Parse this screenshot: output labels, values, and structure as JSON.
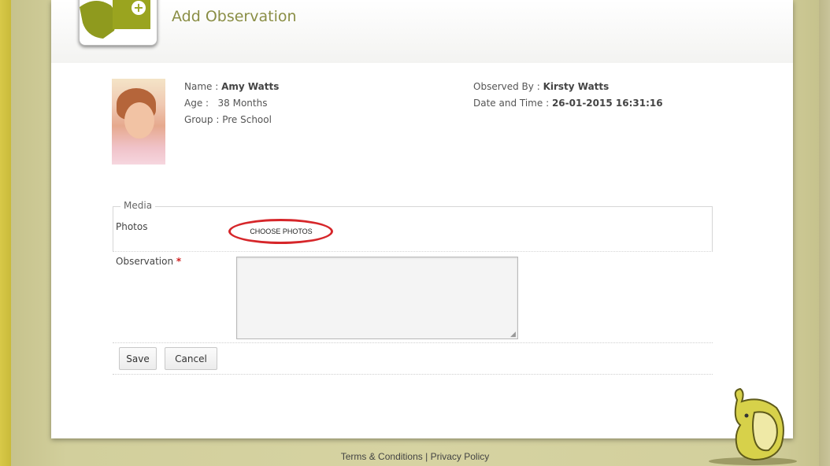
{
  "page": {
    "title": "Add Observation"
  },
  "child": {
    "name_label": "Name : ",
    "name": "Amy Watts",
    "age_label": "Age : ",
    "age": "38 Months",
    "group_label": "Group : ",
    "group": "Pre School"
  },
  "observation_meta": {
    "observed_by_label": "Observed By : ",
    "observed_by": "Kirsty Watts",
    "datetime_label": "Date and Time : ",
    "datetime": "26-01-2015 16:31:16"
  },
  "media": {
    "legend": "Media",
    "photos_label": "Photos",
    "choose_photos": "CHOOSE PHOTOS"
  },
  "observation": {
    "label": "Observation",
    "required_mark": "*",
    "value": ""
  },
  "actions": {
    "save": "Save",
    "cancel": "Cancel"
  },
  "footer": {
    "terms": "Terms & Conditions",
    "separator": "|",
    "privacy": "Privacy Policy"
  },
  "colors": {
    "title": "#8a8e45",
    "brand_green": "#9aa41f",
    "highlight_ring": "#d6262a",
    "required": "#d02020"
  },
  "icons": {
    "logo": "add-observation-plus-icon",
    "mascot": "elephant-mascot-icon",
    "resize": "resize-grip-icon"
  }
}
